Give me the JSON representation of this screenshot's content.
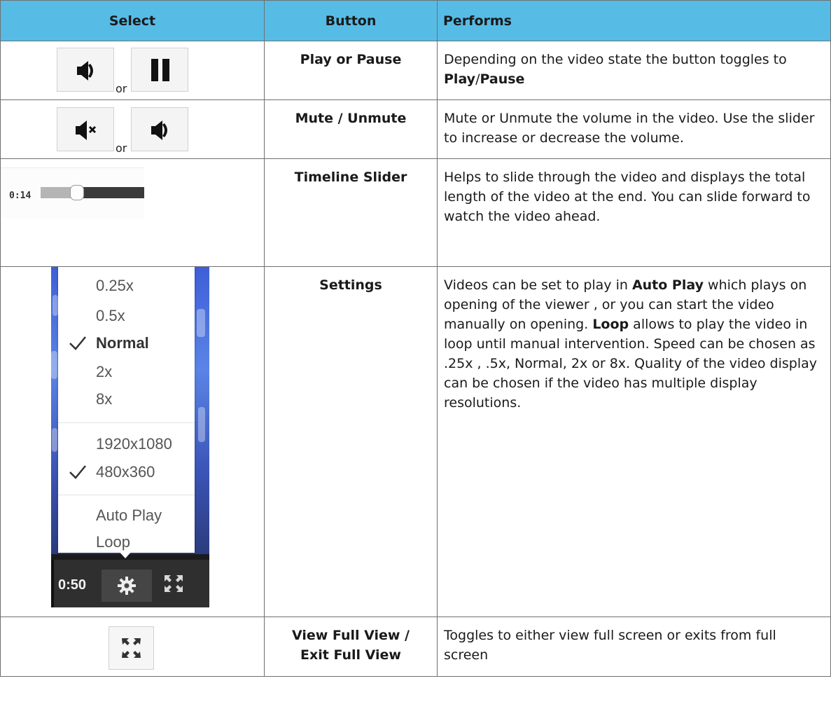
{
  "table": {
    "headers": {
      "select": "Select",
      "button": "Button",
      "performs": "Performs"
    },
    "rows": [
      {
        "button": "Play or Pause",
        "or": "or",
        "performs": {
          "t1": "Depending on the video state the button toggles to ",
          "b1": "Play",
          "t2": "/",
          "b2": "Pause",
          "t3": ""
        }
      },
      {
        "button": "Mute / Unmute",
        "or": "or",
        "performs": "Mute or Unmute the volume in the video. Use the slider to increase or decrease the volume."
      },
      {
        "button": "Timeline Slider",
        "timeline": {
          "time": "0:14",
          "progress": 0.35
        },
        "performs": "Helps to slide through the video and displays the total length of the video at the end. You can slide forward to watch the video ahead."
      },
      {
        "button": "Settings",
        "menu": {
          "speeds": [
            "0.25x",
            "0.5x",
            "Normal",
            "2x",
            "8x"
          ],
          "selected_speed": "Normal",
          "qualities": [
            "1920x1080",
            "480x360"
          ],
          "selected_quality": "480x360",
          "toggles": [
            "Auto Play",
            "Loop"
          ],
          "time": "0:50"
        },
        "performs": {
          "t1": "Videos can be set to play in ",
          "b1": "Auto Play",
          "t2": " which plays on opening of the viewer , or you can start the video manually on opening. ",
          "b2": "Loop",
          "t3": " allows to play the video in loop until manual intervention. Speed can be chosen as .25x , .5x, Normal, 2x or 8x. Quality of the video display can be chosen if the video has multiple display resolutions."
        }
      },
      {
        "button_line1": "View Full View /",
        "button_line2": "Exit Full View",
        "performs": "Toggles to either view full screen or exits from full screen"
      }
    ]
  },
  "icons": {
    "play": "volume-play-icon",
    "pause": "pause-icon",
    "mute": "mute-icon",
    "unmute": "volume-icon",
    "gear": "gear-icon",
    "fullscreen": "fullscreen-icon"
  }
}
